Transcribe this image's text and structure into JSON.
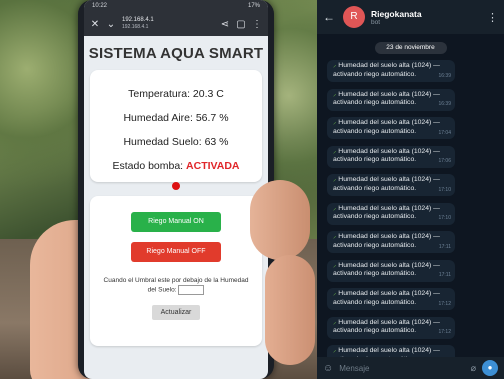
{
  "phone": {
    "status_time": "10:22",
    "status_right": "17%",
    "url": "192.168.4.1",
    "url_sub": "192.168.4.1",
    "title": "SISTEMA AQUA SMART",
    "temperature": "Temperatura: 20.3 C",
    "air_humidity": "Humedad Aire: 56.7 %",
    "soil_humidity": "Humedad Suelo: 63 %",
    "pump_label": "Estado bomba:",
    "pump_value": "ACTIVADA",
    "btn_on": "Riego Manual ON",
    "btn_off": "Riego Manual OFF",
    "umbral_text": "Cuando el Umbral este por debajo de la Humedad del Suelo:",
    "btn_update": "Actualizar"
  },
  "telegram": {
    "chat_name": "Riegokanata",
    "chat_sub": "bot",
    "avatar_letter": "R",
    "date": "23 de noviembre",
    "messages": [
      {
        "text": "Humedad del suelo alta (1024) — activando riego automático.",
        "time": "16:39"
      },
      {
        "text": "Humedad del suelo alta (1024) — activando riego automático.",
        "time": "16:39"
      },
      {
        "text": "Humedad del suelo alta (1024) — activando riego automático.",
        "time": "17:04"
      },
      {
        "text": "Humedad del suelo alta (1024) — activando riego automático.",
        "time": "17:06"
      },
      {
        "text": "Humedad del suelo alta (1024) — activando riego automático.",
        "time": "17:10"
      },
      {
        "text": "Humedad del suelo alta (1024) — activando riego automático.",
        "time": "17:10"
      },
      {
        "text": "Humedad del suelo alta (1024) — activando riego automático.",
        "time": "17:11"
      },
      {
        "text": "Humedad del suelo alta (1024) — activando riego automático.",
        "time": "17:11"
      },
      {
        "text": "Humedad del suelo alta (1024) — activando riego automático.",
        "time": "17:12"
      },
      {
        "text": "Humedad del suelo alta (1024) — activando riego automático.",
        "time": "17:12"
      },
      {
        "text": "Humedad del suelo alta (1024) — activando riego automático.",
        "time": "17:13"
      }
    ],
    "input_placeholder": "Mensaje"
  }
}
